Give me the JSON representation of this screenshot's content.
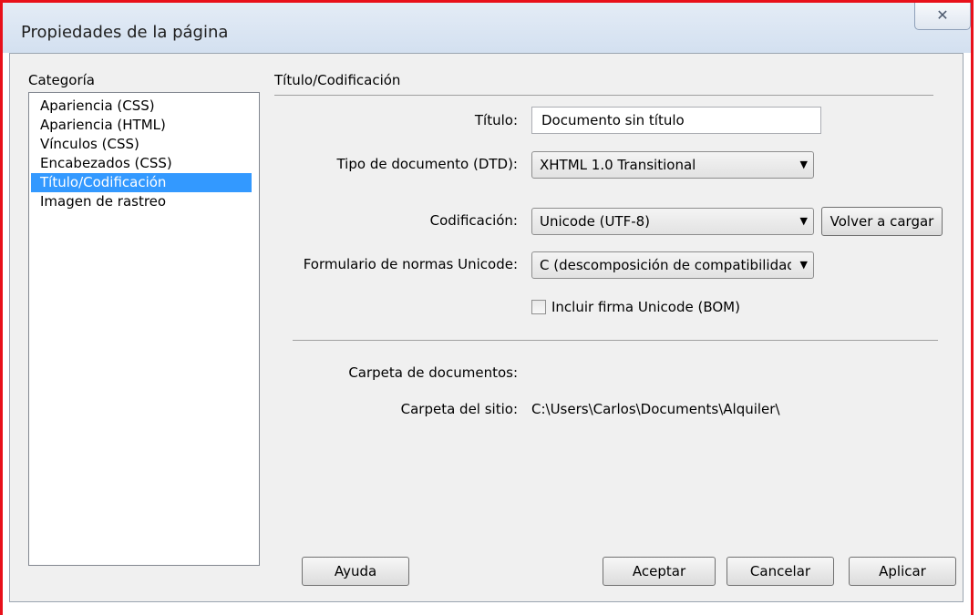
{
  "window": {
    "title": "Propiedades de la página",
    "close_glyph": "✕"
  },
  "category": {
    "label": "Categoría",
    "items": [
      "Apariencia (CSS)",
      "Apariencia (HTML)",
      "Vínculos (CSS)",
      "Encabezados (CSS)",
      "Título/Codificación",
      "Imagen de rastreo"
    ],
    "selected_index": 4
  },
  "section": {
    "title": "Título/Codificación"
  },
  "form": {
    "titulo_label": "Título:",
    "titulo_value": "Documento sin título",
    "dtd_label": "Tipo de documento (DTD):",
    "dtd_value": "XHTML 1.0 Transitional",
    "encoding_label": "Codificación:",
    "encoding_value": "Unicode (UTF-8)",
    "reload_label": "Volver a cargar",
    "normal_form_label": "Formulario de normas Unicode:",
    "normal_form_value": "C (descomposición de compatibilidad",
    "bom_label": "Incluir firma Unicode (BOM)",
    "bom_checked": false,
    "doc_folder_label": "Carpeta de documentos:",
    "doc_folder_value": "",
    "site_folder_label": "Carpeta del sitio:",
    "site_folder_value": "C:\\Users\\Carlos\\Documents\\Alquiler\\"
  },
  "buttons": {
    "help": "Ayuda",
    "ok": "Aceptar",
    "cancel": "Cancelar",
    "apply": "Aplicar"
  }
}
